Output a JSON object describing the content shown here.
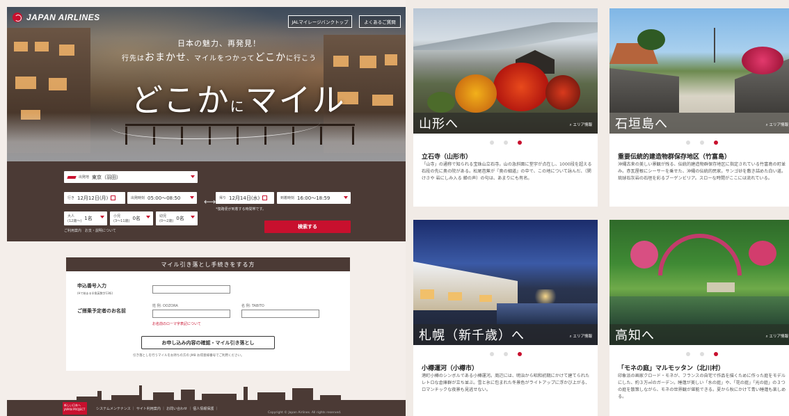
{
  "header": {
    "logo_text": "JAPAN AIRLINES",
    "btn_mileage": "JALマイレージバンクトップ",
    "btn_faq": "よくあるご質問"
  },
  "hero": {
    "catch_line1": "日本の魅力、再発見！",
    "catch_line2_pre": "行先は",
    "catch_line2_big1": "おまかせ",
    "catch_line2_mid": "、マイルをつかって",
    "catch_line2_big2": "どこか",
    "catch_line2_post": "に行こう",
    "title_a": "どこか",
    "title_ni": "に",
    "title_b": "マイル"
  },
  "search": {
    "departure_label": "出発地",
    "departure_value": "東京（羽田）",
    "outbound_label": "行き",
    "outbound_date": "12月12日(月)",
    "outbound_time_label": "出発時刻",
    "outbound_time": "05:00〜08:50",
    "return_label": "帰り",
    "return_date": "12月14日(水)",
    "return_time_label": "到着時刻",
    "return_time": "16:00〜18:59",
    "adult_label": "大人",
    "adult_sub": "(12歳〜)",
    "adult_value": "1名",
    "child_label": "小児",
    "child_sub": "(3〜11歳)",
    "child_value": "0名",
    "infant_label": "幼児",
    "infant_sub": "(0〜2歳)",
    "infant_value": "0名",
    "time_note": "*復路便が到着する時間帯です。",
    "link_guide": "ご利用案内",
    "link_fare": "お支・説明について",
    "search_button": "検索する"
  },
  "form": {
    "heading": "マイル引き落とし手続きをする方",
    "appno_label": "申込番号入力",
    "appno_sub": "(Hで始まる半角英数字13桁)",
    "name_label": "ご搭乗予定者のお名前",
    "surname_hint": "姓 例: OOZORA",
    "given_hint": "名 例: TABITO",
    "name_link": "お名前のローマ字表記について",
    "confirm_button": "お申し込み内容の確認・マイル引き落とし",
    "note": "引き落としを行うマイルをお持ちの方の JMB お得意様番号でご利用ください。"
  },
  "footer": {
    "badge": "新しい日本へ JAPAN PROJECT",
    "links": "システムメンテナンス ｜ サイト利用案内 ｜ お問い合わせ ｜ 個人情報保護 ｜",
    "copyright": "Copyright © Japan Airlines. All rights reserved."
  },
  "cards": [
    {
      "title": "山形へ",
      "area": "エリア情報",
      "heading": "立石寺（山形市）",
      "body": "「山寺」の通称で知られる宝珠山立石寺。山の急斜面に堂宇が点在し、1000段を超える石段の先に奥の院がある。松尾芭蕉が『奥の細道』の中で、この地について詠んだ、（閑けさや 岩にしみ入る 蝉の声）の句は、あまりにも有名。",
      "dot_active": 2
    },
    {
      "title": "石垣島へ",
      "area": "エリア情報",
      "heading": "重要伝統的建造物群保存地区（竹富島）",
      "body": "沖縄古来の美しい景観が残る、伝統的建造物群保存地区に指定されている竹富島の町並み。赤瓦屋根にシーサーを乗せた、沖縄の伝統的民家。サンゴ砂を敷き詰めた白い道。琉球石灰岩の石垣を彩るブーゲンビリア。スローな時間がここには流れている。",
      "dot_active": 2
    },
    {
      "title": "札幌（新千歳）へ",
      "area": "エリア情報",
      "heading": "小樽運河（小樽市）",
      "body": "港町小樽のシンボルである小樽運河。周辺には、明治から昭和初期にかけて建てられたレトロな倉庫群が立ち並ぶ。雪と氷に包まれた冬景色がライトアップに浮かび上がる、ロマンチックな夜景も見逃せない。",
      "dot_active": 2
    },
    {
      "title": "高知へ",
      "area": "エリア情報",
      "heading": "「モネの庭」マルモッタン（北川村）",
      "body": "印象派の画家クロード・モネが、フランスの自宅で作品を描くために作った庭をモデルにした、約３万㎡のガーデン。睡蓮が美しい「水の庭」や、「花の庭」「光の庭」の３つの庭を散策しながら、モネの世界観が堪能できる。夏から秋にかけて青い睡蓮も楽しめる。",
      "dot_active": 2
    }
  ]
}
